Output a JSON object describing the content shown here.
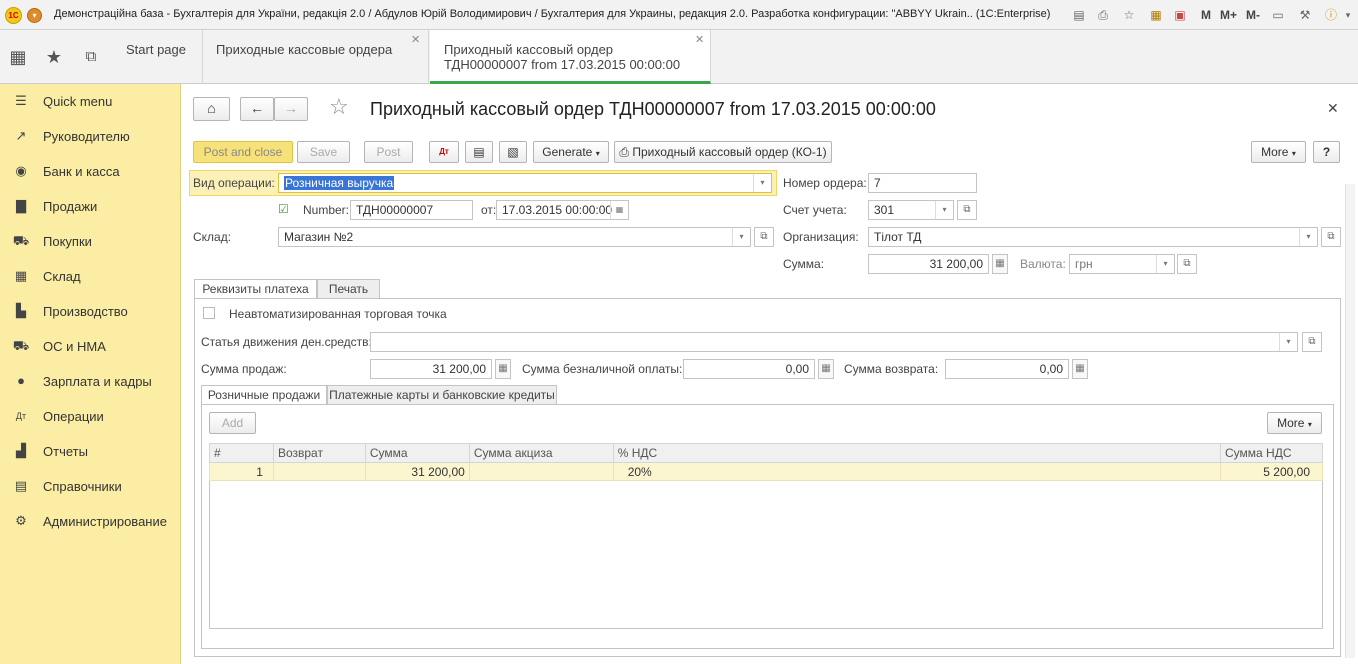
{
  "window": {
    "title": "Демонстраційна база - Бухгалтерія для України, редакція 2.0 / Абдулов Юрій Володимирович / Бухгалтерия для Украины, редакция 2.0. Разработка конфигурации: \"ABBYY Ukrain.. (1C:Enterprise)",
    "logo_text": "1С",
    "right_icons": [
      "save-icon",
      "print-icon",
      "favorites-icon",
      "calculator-icon",
      "calendar-icon"
    ],
    "m_labels": [
      "M",
      "M+",
      "M-"
    ]
  },
  "tabs": [
    {
      "label": "Start page"
    },
    {
      "label": "Приходные кассовые ордера"
    },
    {
      "label_line1": "Приходный кассовый ордер",
      "label_line2": "ТДН00000007 from 17.03.2015 00:00:00"
    }
  ],
  "sidebar": {
    "items": [
      {
        "label": "Quick menu",
        "icon": "menu-icon"
      },
      {
        "label": "Руководителю",
        "icon": "chart-icon"
      },
      {
        "label": "Банк и касса",
        "icon": "bank-icon"
      },
      {
        "label": "Продажи",
        "icon": "bag-icon"
      },
      {
        "label": "Покупки",
        "icon": "cart-icon"
      },
      {
        "label": "Склад",
        "icon": "warehouse-icon"
      },
      {
        "label": "Производство",
        "icon": "factory-icon"
      },
      {
        "label": "ОС и НМА",
        "icon": "truck-icon"
      },
      {
        "label": "Зарплата и кадры",
        "icon": "person-icon"
      },
      {
        "label": "Операции",
        "icon": "debit-credit-icon"
      },
      {
        "label": "Отчеты",
        "icon": "bar-chart-icon"
      },
      {
        "label": "Справочники",
        "icon": "book-icon"
      },
      {
        "label": "Администрирование",
        "icon": "gear-icon"
      }
    ]
  },
  "document": {
    "title": "Приходный кассовый ордер ТДН00000007 from 17.03.2015 00:00:00",
    "toolbar": {
      "post_close": "Post and close",
      "save": "Save",
      "post": "Post",
      "generate": "Generate",
      "print_form": "Приходный кассовый ордер (КО-1)",
      "more": "More",
      "help": "?"
    },
    "fields": {
      "operation_label": "Вид операции:",
      "operation_value": "Розничная выручка",
      "number_label": "Number:",
      "number_value": "ТДН00000007",
      "date_label": "от:",
      "date_value": "17.03.2015 00:00:00",
      "warehouse_label": "Склад:",
      "warehouse_value": "Магазин №2",
      "order_no_label": "Номер ордера:",
      "order_no_value": "7",
      "account_label": "Счет учета:",
      "account_value": "301",
      "org_label": "Организация:",
      "org_value": "Тілот ТД",
      "sum_label": "Сумма:",
      "sum_value": "31 200,00",
      "currency_label": "Валюта:",
      "currency_value": "грн"
    },
    "tabs": [
      "Реквизиты платеха",
      "Печать"
    ],
    "payment": {
      "checkbox_label": "Неавтоматизированная торговая точка",
      "cashflow_label": "Статья движения ден.средств:",
      "cashflow_value": "",
      "sales_sum_label": "Сумма продаж:",
      "sales_sum_value": "31 200,00",
      "noncash_label": "Сумма безналичной оплаты:",
      "noncash_value": "0,00",
      "refund_label": "Сумма возврата:",
      "refund_value": "0,00"
    },
    "subtabs": [
      "Розничные продажи",
      "Платежные карты и банковские кредиты"
    ],
    "grid": {
      "add": "Add",
      "more": "More",
      "columns": [
        "#",
        "Возврат",
        "Сумма",
        "Сумма акциза",
        "% НДС",
        "Сумма НДС"
      ],
      "rows": [
        {
          "n": "1",
          "refund": "",
          "sum": "31 200,00",
          "excise": "",
          "vat_rate": "20%",
          "vat_sum": "5 200,00"
        }
      ]
    }
  }
}
